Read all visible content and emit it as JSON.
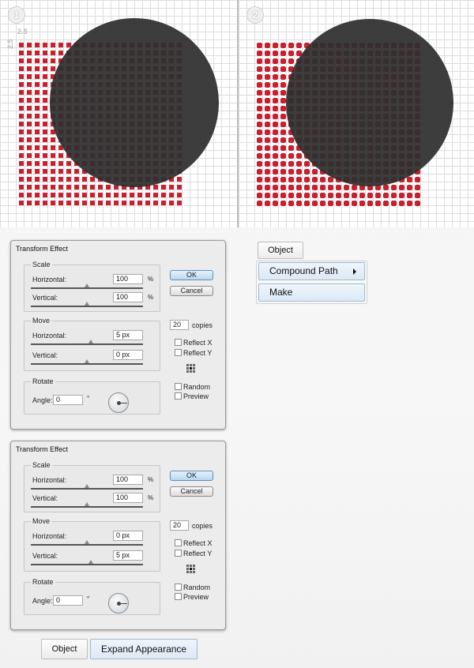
{
  "canvas": {
    "panels": [
      {
        "step": "1",
        "dim_w": "2.5",
        "dim_h": "2.5"
      },
      {
        "step": "2"
      }
    ],
    "colors": {
      "square": "#c8202f",
      "circle": "#2e2e2e",
      "grid": "#dcdcdc"
    }
  },
  "dialogs": [
    {
      "title": "Transform Effect",
      "scale": {
        "label": "Scale",
        "horizontal_label": "Horizontal:",
        "horizontal": "100",
        "horizontal_unit": "%",
        "vertical_label": "Vertical:",
        "vertical": "100",
        "vertical_unit": "%"
      },
      "move": {
        "label": "Move",
        "horizontal_label": "Horizontal:",
        "horizontal": "5 px",
        "vertical_label": "Vertical:",
        "vertical": "0 px"
      },
      "rotate": {
        "label": "Rotate",
        "angle_label": "Angle:",
        "angle": "0",
        "angle_unit": "°"
      },
      "ok": "OK",
      "cancel": "Cancel",
      "copies": "20",
      "copies_label": "copies",
      "reflect_x": "Reflect X",
      "reflect_y": "Reflect Y",
      "random": "Random",
      "preview": "Preview"
    },
    {
      "title": "Transform Effect",
      "scale": {
        "label": "Scale",
        "horizontal_label": "Horizontal:",
        "horizontal": "100",
        "horizontal_unit": "%",
        "vertical_label": "Vertical:",
        "vertical": "100",
        "vertical_unit": "%"
      },
      "move": {
        "label": "Move",
        "horizontal_label": "Horizontal:",
        "horizontal": "0 px",
        "vertical_label": "Vertical:",
        "vertical": "5 px"
      },
      "rotate": {
        "label": "Rotate",
        "angle_label": "Angle:",
        "angle": "0",
        "angle_unit": "°"
      },
      "ok": "OK",
      "cancel": "Cancel",
      "copies": "20",
      "copies_label": "copies",
      "reflect_x": "Reflect X",
      "reflect_y": "Reflect Y",
      "random": "Random",
      "preview": "Preview"
    }
  ],
  "menu_top": {
    "object": "Object",
    "compound_path": "Compound Path",
    "make": "Make"
  },
  "menu_bottom": {
    "object": "Object",
    "expand_appearance": "Expand Appearance"
  }
}
